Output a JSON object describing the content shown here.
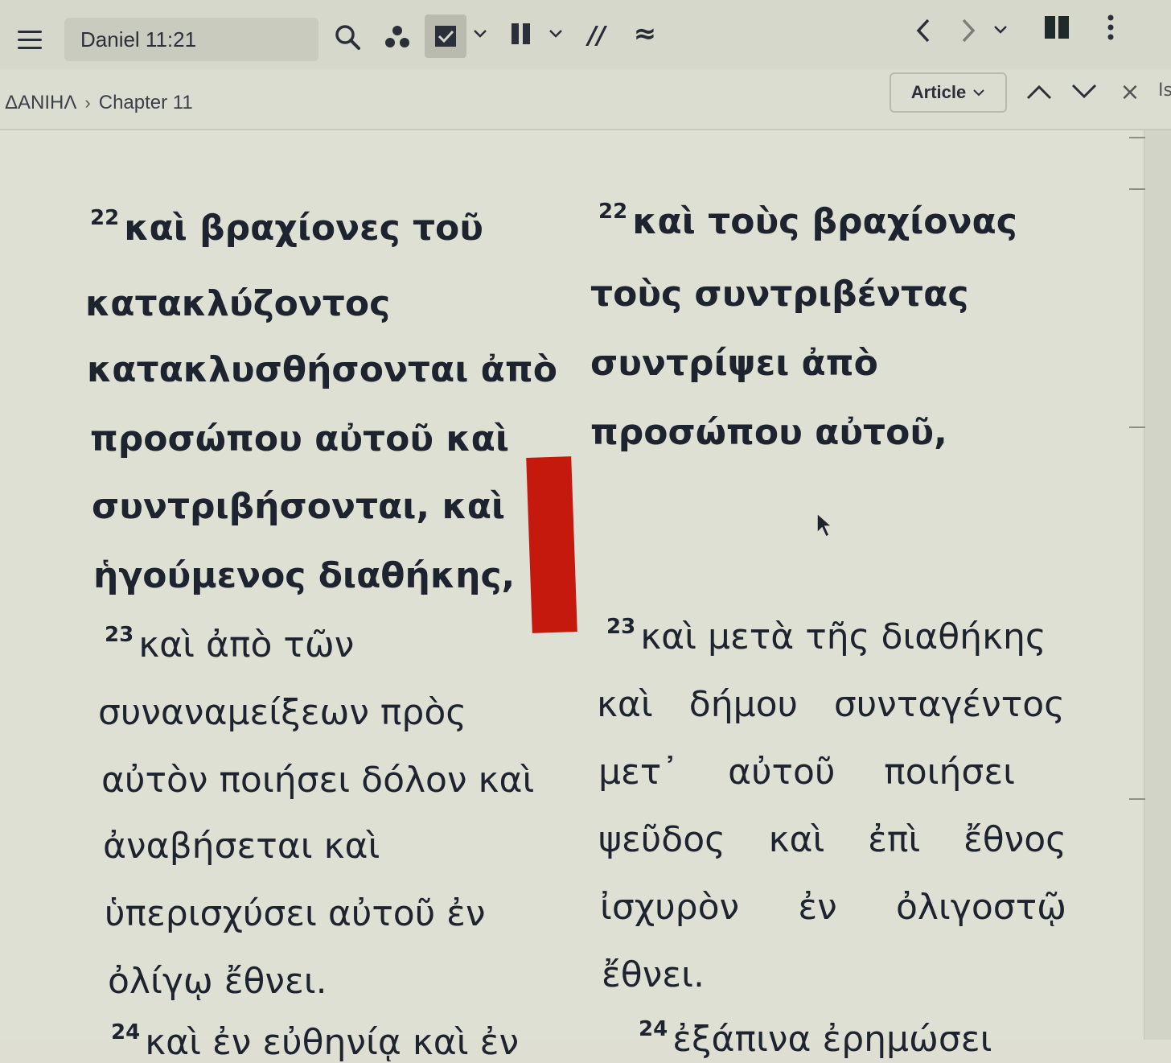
{
  "toolbar": {
    "reference": "Daniel 11:21",
    "icons": [
      "menu-icon",
      "search-icon",
      "group-icon",
      "checkbox-icon",
      "chevron-down-icon",
      "pause-icon",
      "parallel-icon",
      "approx-icon",
      "chevron-left-icon",
      "chevron-right-icon",
      "panes-icon",
      "more-icon"
    ],
    "parallel_glyph": "//",
    "approx_glyph": "≈"
  },
  "breadcrumb": {
    "book": "ΔΑΝΙΗΛ",
    "separator": "›",
    "chapter": "Chapter 11"
  },
  "subbar": {
    "article_label": "Article",
    "close_glyph": "×",
    "edge_text": "Is"
  },
  "left_column": {
    "v22": {
      "number": "22",
      "lines": [
        "καὶ βραχίονες τοῦ",
        "κατακλύζοντος",
        "κατακλυσθήσονται ἀπὸ",
        "προσώπου αὐτοῦ καὶ",
        "συντριβήσονται, καὶ",
        "ἡγούμενος διαθήκης,"
      ]
    },
    "v23": {
      "number": "23",
      "lines": [
        "καὶ ἀπὸ τῶν",
        "συναναμείξεων πρὸς",
        "αὐτὸν ποιήσει δόλον καὶ",
        "ἀναβήσεται καὶ",
        "ὑπερισχύσει αὐτοῦ ἐν",
        "ὀλίγῳ ἔθνει."
      ]
    },
    "v24": {
      "number": "24",
      "partial": "καὶ ἐν εὐθηνίᾳ καὶ ἐν"
    }
  },
  "right_column": {
    "v22": {
      "number": "22",
      "lines": [
        "καὶ τοὺς βραχίονας",
        "τοὺς συντριβέντας",
        "συντρίψει ἀπὸ",
        "προσώπου αὐτοῦ,"
      ]
    },
    "v23": {
      "number": "23",
      "first": "καὶ μετὰ τῆς διαθήκης",
      "rows": [
        [
          "καὶ",
          "δήμου",
          "συνταγέντος"
        ],
        [
          "μετ᾽",
          "αὐτοῦ",
          "ποιήσει"
        ],
        [
          "ψεῦδος",
          "καὶ",
          "ἐπὶ",
          "ἔθνος"
        ],
        [
          "ἰσχυρὸν",
          "ἐν",
          "ὀλιγοστῷ"
        ]
      ],
      "last": "ἔθνει."
    },
    "v24": {
      "number": "24",
      "partial": "ἐξάπινα ἐρημώσει"
    }
  },
  "colors": {
    "background": "#dfe0d4",
    "text": "#1e2330",
    "marker": "#c4190c"
  }
}
